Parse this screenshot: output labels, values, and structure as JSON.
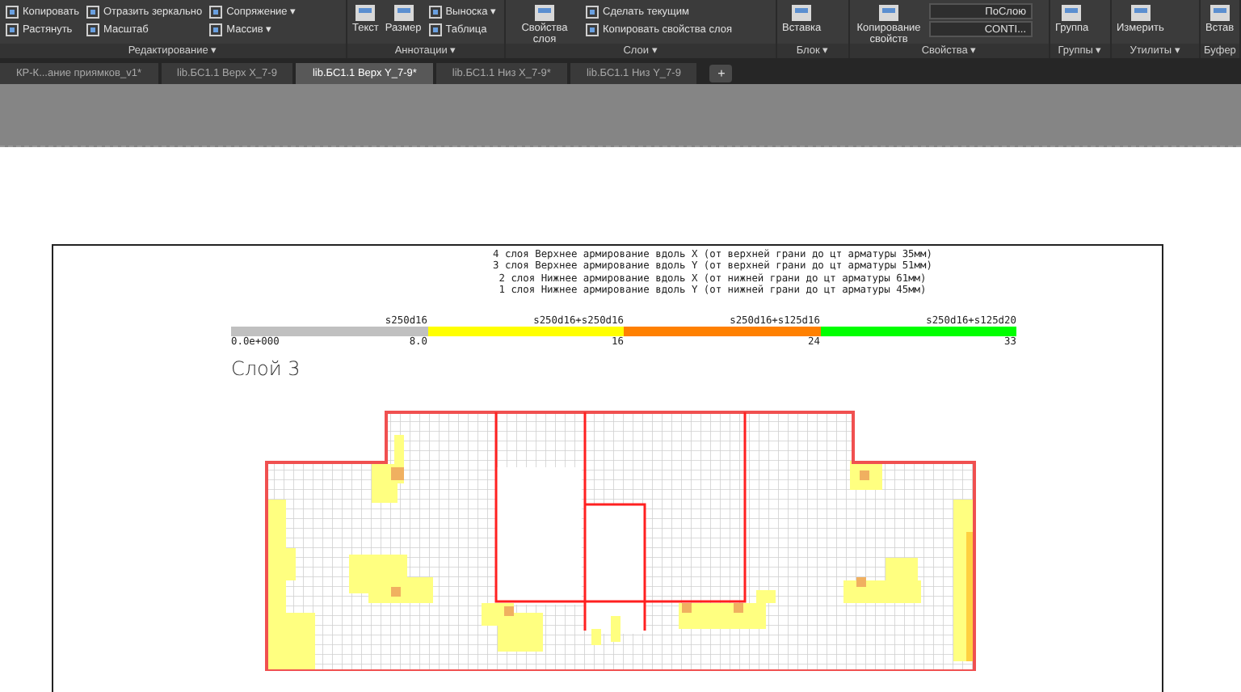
{
  "ribbon": {
    "panels": [
      {
        "title": "Редактирование ▾",
        "tools": [
          {
            "kind": "small",
            "label": "Копировать"
          },
          {
            "kind": "small",
            "label": "Растянуть"
          },
          {
            "kind": "small",
            "label": "Отразить зеркально"
          },
          {
            "kind": "small",
            "label": "Масштаб"
          },
          {
            "kind": "small",
            "label": "Сопряжение ▾"
          },
          {
            "kind": "small",
            "label": "Массив ▾"
          }
        ]
      },
      {
        "title": "Аннотации ▾",
        "tools": [
          {
            "kind": "large",
            "label": "Текст"
          },
          {
            "kind": "large",
            "label": "Размер"
          },
          {
            "kind": "small",
            "label": "Выноска ▾"
          },
          {
            "kind": "small",
            "label": "Таблица"
          }
        ]
      },
      {
        "title": "Слои ▾",
        "tools": [
          {
            "kind": "large",
            "label": "Свойства слоя"
          },
          {
            "kind": "small",
            "label": "Сделать текущим"
          },
          {
            "kind": "small",
            "label": "Копировать свойства слоя"
          }
        ]
      },
      {
        "title": "Блок ▾",
        "tools": [
          {
            "kind": "large",
            "label": "Вставка"
          }
        ]
      },
      {
        "title": "Свойства ▾",
        "tools": [
          {
            "kind": "large",
            "label": "Копирование свойств"
          },
          {
            "kind": "dropdown",
            "label": "ПоСлою"
          },
          {
            "kind": "dropdown",
            "label": "CONTI..."
          }
        ]
      },
      {
        "title": "Группы ▾",
        "tools": [
          {
            "kind": "large",
            "label": "Группа"
          }
        ]
      },
      {
        "title": "Утилиты ▾",
        "tools": [
          {
            "kind": "large",
            "label": "Измерить"
          }
        ]
      },
      {
        "title": "Буфер",
        "tools": [
          {
            "kind": "large",
            "label": "Встав"
          }
        ]
      }
    ]
  },
  "tabs": [
    {
      "label": "КР-К...ание приямков_v1*",
      "selected": false
    },
    {
      "label": "lib.БС1.1 Верх X_7-9",
      "selected": false
    },
    {
      "label": "lib.БС1.1 Верх Y_7-9*",
      "selected": true
    },
    {
      "label": "lib.БС1.1 Низ X_7-9*",
      "selected": false
    },
    {
      "label": "lib.БС1.1 Низ Y_7-9",
      "selected": false
    }
  ],
  "new_tab": "+",
  "drawing": {
    "legend": [
      "4 слоя Верхнее армирование вдоль X (от верхней грани до цт арматуры 35мм)",
      "3 слоя Верхнее армирование вдоль Y (от верхней грани до цт арматуры 51мм)",
      "2 слоя Нижнее армирование вдоль X (от нижней грани до цт арматуры 61мм)",
      "1 слоя Нижнее армирование вдоль Y (от нижней грани до цт арматуры 45мм)"
    ],
    "scale_start": "0.0e+000",
    "scale": [
      {
        "color": "#c0c0c0",
        "label": "s250d16",
        "tick": "8.0"
      },
      {
        "color": "#ffff00",
        "label": "s250d16+s250d16",
        "tick": "16"
      },
      {
        "color": "#ff8000",
        "label": "s250d16+s125d16",
        "tick": "24"
      },
      {
        "color": "#00ff00",
        "label": "s250d16+s125d20",
        "tick": "33"
      }
    ],
    "layer_title": "Слой 3"
  }
}
